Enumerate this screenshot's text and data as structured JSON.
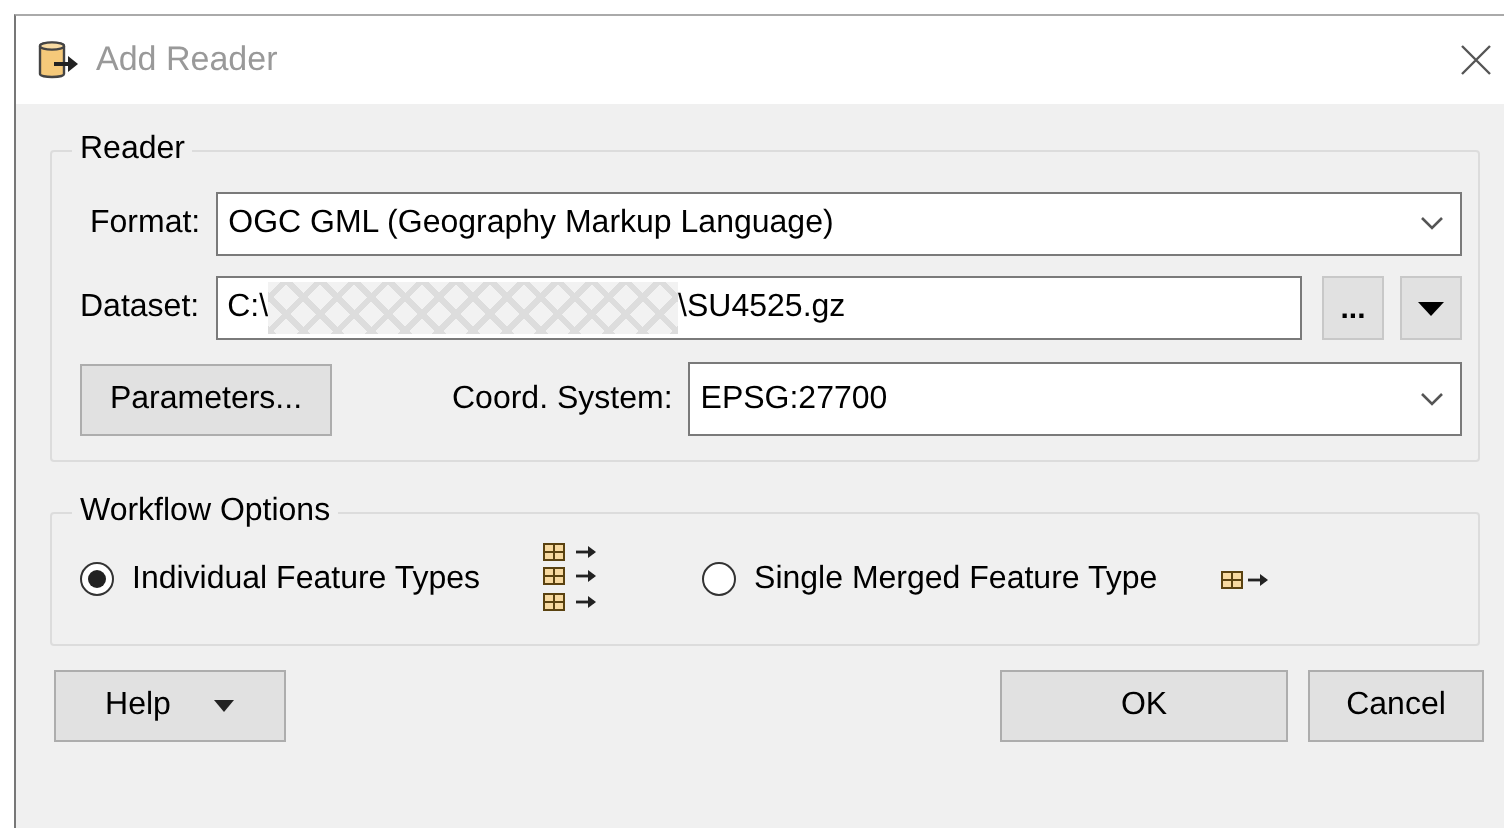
{
  "window": {
    "title": "Add Reader"
  },
  "reader": {
    "legend": "Reader",
    "format": {
      "label": "Format:",
      "value": "OGC GML (Geography Markup Language)"
    },
    "dataset": {
      "label": "Dataset:",
      "value_start": "C:\\",
      "value_end": "\\SU4525.gz",
      "browse": "..."
    },
    "parameters": "Parameters...",
    "coord_system": {
      "label": "Coord. System:",
      "value": "EPSG:27700"
    }
  },
  "workflow": {
    "legend": "Workflow Options",
    "options": [
      {
        "label": "Individual Feature Types",
        "selected": true,
        "kind": "multi"
      },
      {
        "label": "Single Merged Feature Type",
        "selected": false,
        "kind": "single"
      }
    ]
  },
  "buttons": [
    {
      "label": "Help",
      "kind": "menu"
    },
    {
      "label": "OK",
      "kind": "plain"
    },
    {
      "label": "Cancel",
      "kind": "plain"
    }
  ]
}
